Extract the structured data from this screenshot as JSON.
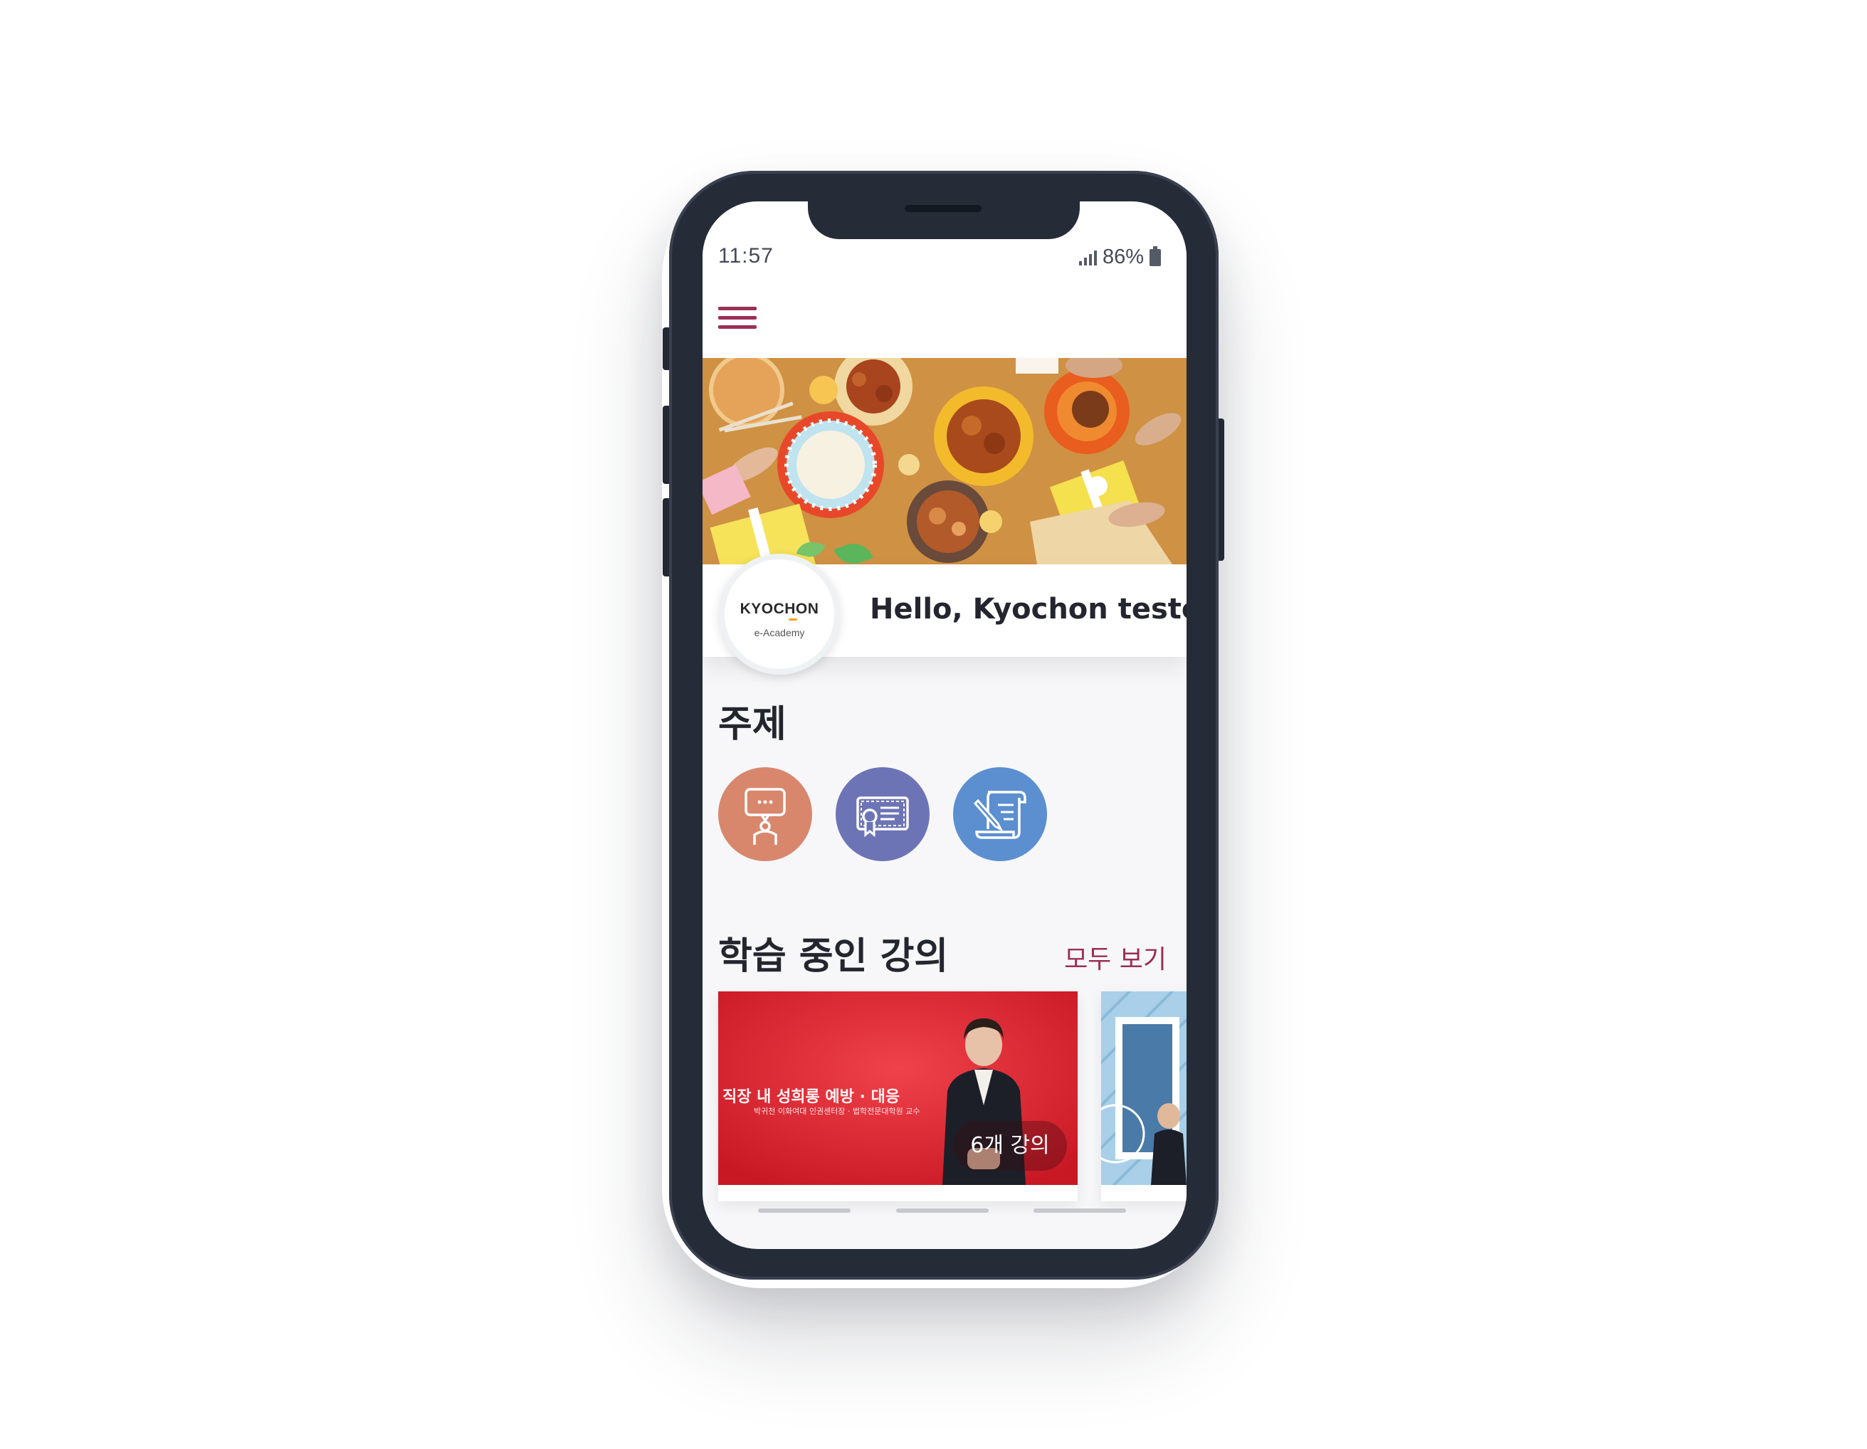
{
  "status_bar": {
    "time": "11:57",
    "battery": "86%",
    "signal_icon": "signal-icon",
    "battery_icon": "battery-icon"
  },
  "header": {
    "menu_icon": "hamburger-menu-icon",
    "accent_color": "#9b2f55"
  },
  "banner": {
    "image": "food-table-photo"
  },
  "profile": {
    "logo_brand": "KYOCHON",
    "logo_sub": "e-Academy",
    "greeting": "Hello, Kyochon tester"
  },
  "topics": {
    "title": "주제",
    "items": [
      {
        "icon": "presenter-icon",
        "color": "#d8876d"
      },
      {
        "icon": "certificate-icon",
        "color": "#6d74b6"
      },
      {
        "icon": "document-pen-icon",
        "color": "#5b8fd0"
      }
    ]
  },
  "courses": {
    "title": "학습 중인 강의",
    "view_all": "모두 보기",
    "items": [
      {
        "thumb_title": "직장 내 성희롱 예방 · 대응",
        "thumb_sub": "박귀천 이화여대 인권센터장 · 법학전문대학원 교수",
        "count": "6개 강의",
        "color": "#e8303c"
      },
      {
        "color": "#a9d0e8"
      }
    ]
  }
}
